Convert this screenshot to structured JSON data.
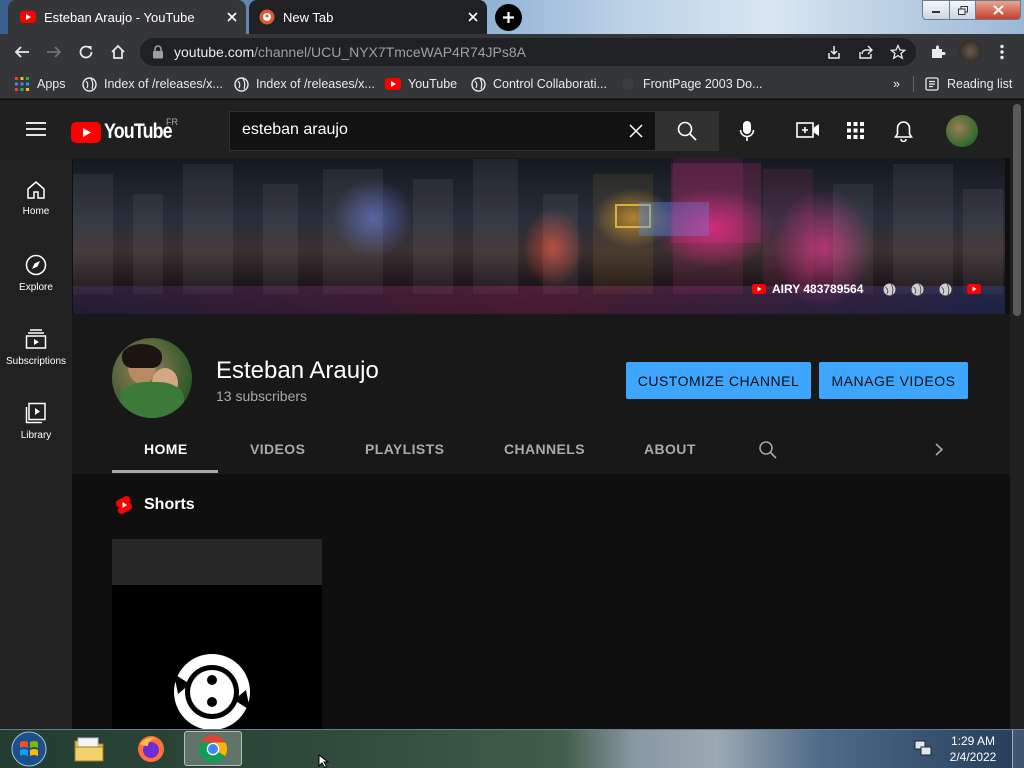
{
  "browser": {
    "tabs": [
      {
        "title": "Esteban Araujo - YouTube"
      },
      {
        "title": "New Tab"
      }
    ],
    "url_host": "youtube.com",
    "url_path": "/channel/UCU_NYX7TmceWAP4R74JPs8A",
    "bookmarks": [
      {
        "label": "Apps"
      },
      {
        "label": "Index of /releases/x..."
      },
      {
        "label": "Index of /releases/x..."
      },
      {
        "label": "YouTube"
      },
      {
        "label": "Control Collaborati..."
      },
      {
        "label": "FrontPage 2003 Do..."
      }
    ],
    "overflow": "»",
    "reading_list": "Reading list"
  },
  "youtube": {
    "logo_text": "YouTube",
    "logo_region": "FR",
    "search_value": "esteban araujo",
    "sidebar": [
      {
        "label": "Home",
        "icon": "home-icon"
      },
      {
        "label": "Explore",
        "icon": "compass-icon"
      },
      {
        "label": "Subscriptions",
        "icon": "subscriptions-icon"
      },
      {
        "label": "Library",
        "icon": "library-icon"
      }
    ],
    "banner_link": "AIRY 483789564",
    "channel": {
      "name": "Esteban Araujo",
      "subscribers": "13 subscribers",
      "customize_label": "CUSTOMIZE CHANNEL",
      "manage_label": "MANAGE VIDEOS",
      "tabs": [
        "HOME",
        "VIDEOS",
        "PLAYLISTS",
        "CHANNELS",
        "ABOUT"
      ]
    },
    "shorts_title": "Shorts"
  },
  "taskbar": {
    "time": "1:29 AM",
    "date": "2/4/2022"
  },
  "colors": {
    "accent_blue": "#3ea6ff",
    "youtube_red": "#ff0000"
  }
}
